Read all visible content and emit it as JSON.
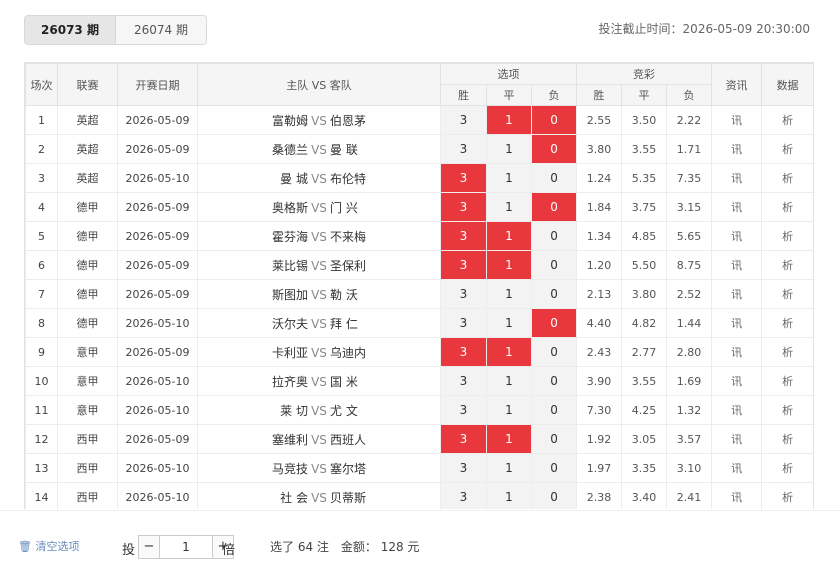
{
  "tabs": [
    {
      "label": "26073 期",
      "active": true
    },
    {
      "label": "26074 期",
      "active": false
    }
  ],
  "deadline": "投注截止时间：2026-05-09 20:30:00",
  "headers": {
    "num": "场次",
    "league": "联赛",
    "date": "开赛日期",
    "match": "主队 VS 客队",
    "options": "选项",
    "jingcai": "竞彩",
    "news": "资讯",
    "data": "数据",
    "win": "胜",
    "draw": "平",
    "lose": "负"
  },
  "vs_label": "VS",
  "news_label": "讯",
  "data_label": "析",
  "rows": [
    {
      "num": "1",
      "league": "英超",
      "date": "2026-05-09",
      "home": "富勒姆",
      "away": "伯恩茅",
      "opts": [
        "3",
        "1",
        "0"
      ],
      "sel": [
        false,
        true,
        true
      ],
      "odds": [
        "2.55",
        "3.50",
        "2.22"
      ]
    },
    {
      "num": "2",
      "league": "英超",
      "date": "2026-05-09",
      "home": "桑德兰",
      "away": "曼 联",
      "opts": [
        "3",
        "1",
        "0"
      ],
      "sel": [
        false,
        false,
        true
      ],
      "odds": [
        "3.80",
        "3.55",
        "1.71"
      ]
    },
    {
      "num": "3",
      "league": "英超",
      "date": "2026-05-10",
      "home": "曼 城",
      "away": "布伦特",
      "opts": [
        "3",
        "1",
        "0"
      ],
      "sel": [
        true,
        false,
        false
      ],
      "odds": [
        "1.24",
        "5.35",
        "7.35"
      ]
    },
    {
      "num": "4",
      "league": "德甲",
      "date": "2026-05-09",
      "home": "奥格斯",
      "away": "门 兴",
      "opts": [
        "3",
        "1",
        "0"
      ],
      "sel": [
        true,
        false,
        true
      ],
      "odds": [
        "1.84",
        "3.75",
        "3.15"
      ]
    },
    {
      "num": "5",
      "league": "德甲",
      "date": "2026-05-09",
      "home": "霍芬海",
      "away": "不来梅",
      "opts": [
        "3",
        "1",
        "0"
      ],
      "sel": [
        true,
        true,
        false
      ],
      "odds": [
        "1.34",
        "4.85",
        "5.65"
      ]
    },
    {
      "num": "6",
      "league": "德甲",
      "date": "2026-05-09",
      "home": "莱比锡",
      "away": "圣保利",
      "opts": [
        "3",
        "1",
        "0"
      ],
      "sel": [
        true,
        true,
        false
      ],
      "odds": [
        "1.20",
        "5.50",
        "8.75"
      ]
    },
    {
      "num": "7",
      "league": "德甲",
      "date": "2026-05-09",
      "home": "斯图加",
      "away": "勒 沃",
      "opts": [
        "3",
        "1",
        "0"
      ],
      "sel": [
        false,
        false,
        false
      ],
      "odds": [
        "2.13",
        "3.80",
        "2.52"
      ]
    },
    {
      "num": "8",
      "league": "德甲",
      "date": "2026-05-10",
      "home": "沃尔夫",
      "away": "拜 仁",
      "opts": [
        "3",
        "1",
        "0"
      ],
      "sel": [
        false,
        false,
        true
      ],
      "odds": [
        "4.40",
        "4.82",
        "1.44"
      ]
    },
    {
      "num": "9",
      "league": "意甲",
      "date": "2026-05-09",
      "home": "卡利亚",
      "away": "乌迪内",
      "opts": [
        "3",
        "1",
        "0"
      ],
      "sel": [
        true,
        true,
        false
      ],
      "odds": [
        "2.43",
        "2.77",
        "2.80"
      ]
    },
    {
      "num": "10",
      "league": "意甲",
      "date": "2026-05-10",
      "home": "拉齐奥",
      "away": "国 米",
      "opts": [
        "3",
        "1",
        "0"
      ],
      "sel": [
        false,
        false,
        false
      ],
      "odds": [
        "3.90",
        "3.55",
        "1.69"
      ]
    },
    {
      "num": "11",
      "league": "意甲",
      "date": "2026-05-10",
      "home": "莱 切",
      "away": "尤 文",
      "opts": [
        "3",
        "1",
        "0"
      ],
      "sel": [
        false,
        false,
        false
      ],
      "odds": [
        "7.30",
        "4.25",
        "1.32"
      ]
    },
    {
      "num": "12",
      "league": "西甲",
      "date": "2026-05-09",
      "home": "塞维利",
      "away": "西班人",
      "opts": [
        "3",
        "1",
        "0"
      ],
      "sel": [
        true,
        true,
        false
      ],
      "odds": [
        "1.92",
        "3.05",
        "3.57"
      ]
    },
    {
      "num": "13",
      "league": "西甲",
      "date": "2026-05-10",
      "home": "马竞技",
      "away": "塞尔塔",
      "opts": [
        "3",
        "1",
        "0"
      ],
      "sel": [
        false,
        false,
        false
      ],
      "odds": [
        "1.97",
        "3.35",
        "3.10"
      ]
    },
    {
      "num": "14",
      "league": "西甲",
      "date": "2026-05-10",
      "home": "社 会",
      "away": "贝蒂斯",
      "opts": [
        "3",
        "1",
        "0"
      ],
      "sel": [
        false,
        false,
        false
      ],
      "odds": [
        "2.38",
        "3.40",
        "2.41"
      ]
    }
  ],
  "footer": {
    "clear_label": "清空选项",
    "tou_label": "投",
    "multiplier": "1",
    "minus": "−",
    "plus": "+",
    "bei_label": "倍",
    "summary": "选了 64 注　金额： 128 元"
  },
  "colors": {
    "selected": "#e8373d",
    "option_bg": "#f3f3f3"
  }
}
